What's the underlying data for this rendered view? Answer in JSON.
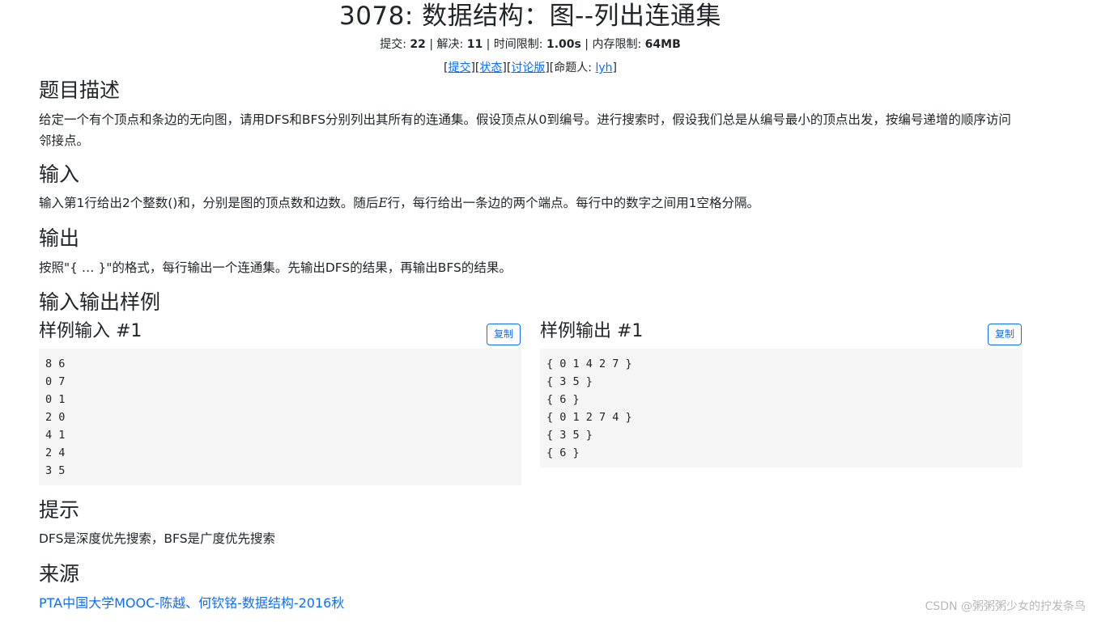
{
  "title": "3078: 数据结构：图--列出连通集",
  "meta": {
    "submit_label": "提交: ",
    "submit_count": "22",
    "solved_label": "解决: ",
    "solved_count": "11",
    "time_label": "时间限制: ",
    "time_value": "1.00s",
    "mem_label": "内存限制: ",
    "mem_value": "64MB",
    "separator": " | "
  },
  "actions": {
    "submit": "提交",
    "status": "状态",
    "discuss": "讨论版",
    "author_label": "命题人: ",
    "author": "lyh"
  },
  "sections": {
    "description": {
      "heading": "题目描述",
      "text": "给定一个有个顶点和条边的无向图，请用DFS和BFS分别列出其所有的连通集。假设顶点从0到编号。进行搜索时，假设我们总是从编号最小的顶点出发，按编号递增的顺序访问邻接点。"
    },
    "input": {
      "heading": "输入",
      "text_before": "输入第1行给出2个整数()和，分别是图的顶点数和边数。随后",
      "math": "E",
      "text_after": "行，每行给出一条边的两个端点。每行中的数字之间用1空格分隔。"
    },
    "output": {
      "heading": "输出",
      "text": "按照\"{  …  }\"的格式，每行输出一个连通集。先输出DFS的结果，再输出BFS的结果。"
    },
    "samples": {
      "heading": "输入输出样例",
      "input_heading": "样例输入 #1",
      "output_heading": "样例输出 #1",
      "copy_label": "复制",
      "input_lines": [
        "8 6",
        "0 7",
        "0 1",
        "2 0",
        "4 1",
        "2 4",
        "3 5"
      ],
      "output_lines": [
        "{ 0 1 4 2 7 }",
        "{ 3 5 }",
        "{ 6 }",
        "{ 0 1 2 7 4 }",
        "{ 3 5 }",
        "{ 6 }"
      ]
    },
    "hint": {
      "heading": "提示",
      "text": "DFS是深度优先搜索，BFS是广度优先搜索"
    },
    "source": {
      "heading": "来源",
      "link": "PTA中国大学MOOC-陈越、何钦铭-数据结构-2016秋"
    }
  },
  "watermark": "CSDN @粥粥粥少女的拧发条鸟",
  "colors": {
    "link": "#0d6efd",
    "code_bg": "#f5f5f5",
    "text": "#212529"
  }
}
